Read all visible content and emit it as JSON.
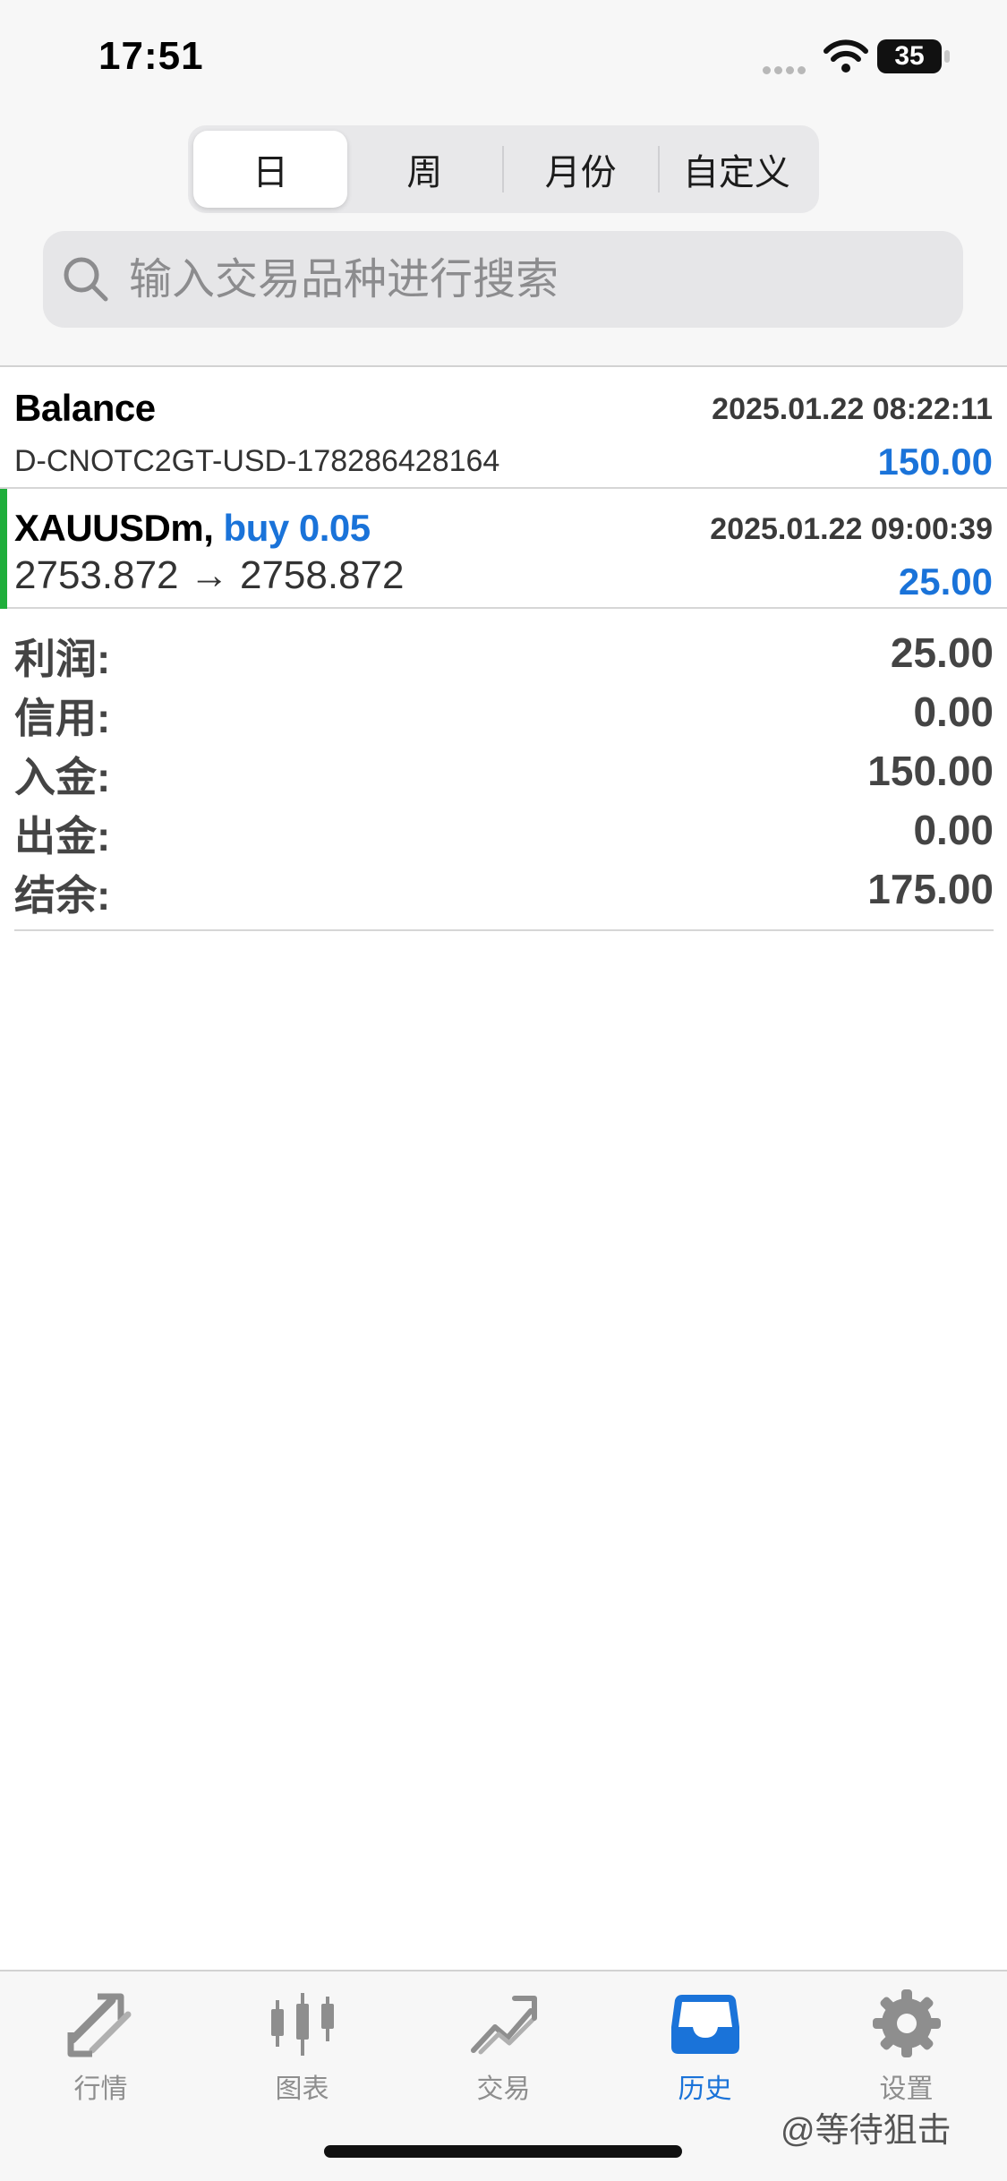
{
  "status_bar": {
    "time": "17:51",
    "battery": "35"
  },
  "segments": [
    {
      "label": "日",
      "active": true
    },
    {
      "label": "周",
      "active": false
    },
    {
      "label": "月份",
      "active": false
    },
    {
      "label": "自定义",
      "active": false
    }
  ],
  "search": {
    "placeholder": "输入交易品种进行搜索"
  },
  "history": [
    {
      "title": "Balance",
      "time": "2025.01.22 08:22:11",
      "subtitle": "D-CNOTC2GT-USD-178286428164",
      "amount": "150.00"
    },
    {
      "symbol": "XAUUSDm,",
      "side": "buy 0.05",
      "time": "2025.01.22 09:00:39",
      "prices": "2753.872 → 2758.872",
      "amount": "25.00"
    }
  ],
  "summary": [
    {
      "label": "利润:",
      "value": "25.00"
    },
    {
      "label": "信用:",
      "value": "0.00"
    },
    {
      "label": "入金:",
      "value": "150.00"
    },
    {
      "label": "出金:",
      "value": "0.00"
    },
    {
      "label": "结余:",
      "value": "175.00"
    }
  ],
  "tabs": [
    {
      "label": "行情",
      "icon": "quotes-arrows-icon",
      "active": false
    },
    {
      "label": "图表",
      "icon": "candlestick-chart-icon",
      "active": false
    },
    {
      "label": "交易",
      "icon": "trade-trend-icon",
      "active": false
    },
    {
      "label": "历史",
      "icon": "history-inbox-icon",
      "active": true
    },
    {
      "label": "设置",
      "icon": "settings-gear-icon",
      "active": false
    }
  ],
  "watermark": "@等待狙击",
  "colors": {
    "accent": "#1a73d9",
    "buy_marker": "#1fae3b"
  }
}
